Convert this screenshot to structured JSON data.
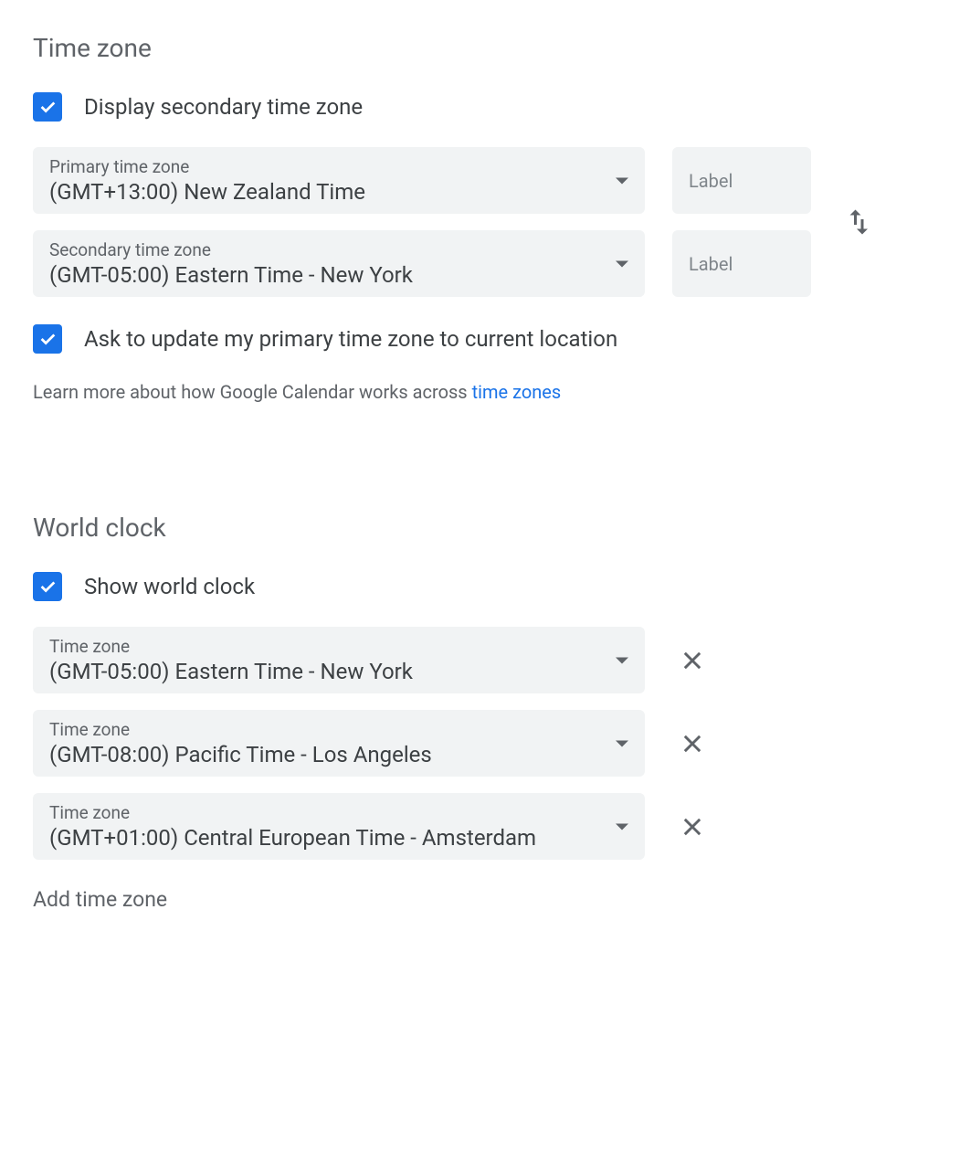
{
  "timezone": {
    "title": "Time zone",
    "display_secondary_label": "Display secondary time zone",
    "primary": {
      "label": "Primary time zone",
      "value": "(GMT+13:00) New Zealand Time",
      "label_placeholder": "Label"
    },
    "secondary": {
      "label": "Secondary time zone",
      "value": "(GMT-05:00) Eastern Time - New York",
      "label_placeholder": "Label"
    },
    "ask_update_label": "Ask to update my primary time zone to current location",
    "help_text_prefix": "Learn more about how Google Calendar works across ",
    "help_link_text": "time zones"
  },
  "worldclock": {
    "title": "World clock",
    "show_label": "Show world clock",
    "zone_label": "Time zone",
    "zones": [
      "(GMT-05:00) Eastern Time - New York",
      "(GMT-08:00) Pacific Time - Los Angeles",
      "(GMT+01:00) Central European Time - Amsterdam"
    ],
    "add_label": "Add time zone"
  }
}
